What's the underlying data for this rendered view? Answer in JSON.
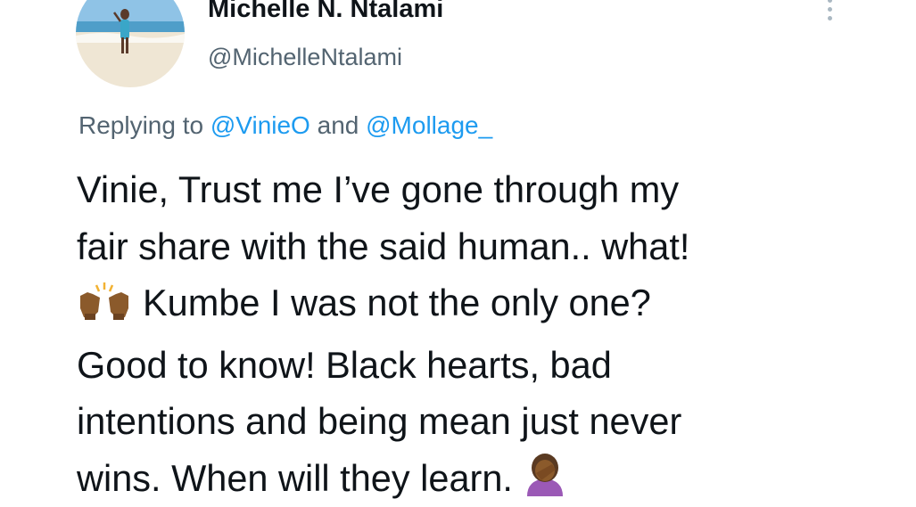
{
  "user": {
    "display_name": "Michelle N. Ntalami",
    "handle": "@MichelleNtalami",
    "avatar_icon": "profile-photo-beach"
  },
  "menu": {
    "icon": "more-options-icon"
  },
  "reply": {
    "prefix": "Replying to ",
    "mention_1": "@VinieO",
    "connector": " and ",
    "mention_2": "@Mollage_"
  },
  "body": {
    "line_1": "Vinie, Trust me I’ve gone through my",
    "line_2": "fair share with the said human.. what!",
    "line_3_emoji": "raising-hands-emoji",
    "line_3": "Kumbe I was not the only one?",
    "line_4": "Good to know! Black hearts, bad",
    "line_5": "intentions and being mean just never",
    "line_6": "wins. When will they learn.",
    "line_6_emoji": "facepalm-emoji"
  },
  "colors": {
    "text": "#0f1419",
    "secondary": "#536471",
    "link": "#1d9bf0"
  }
}
